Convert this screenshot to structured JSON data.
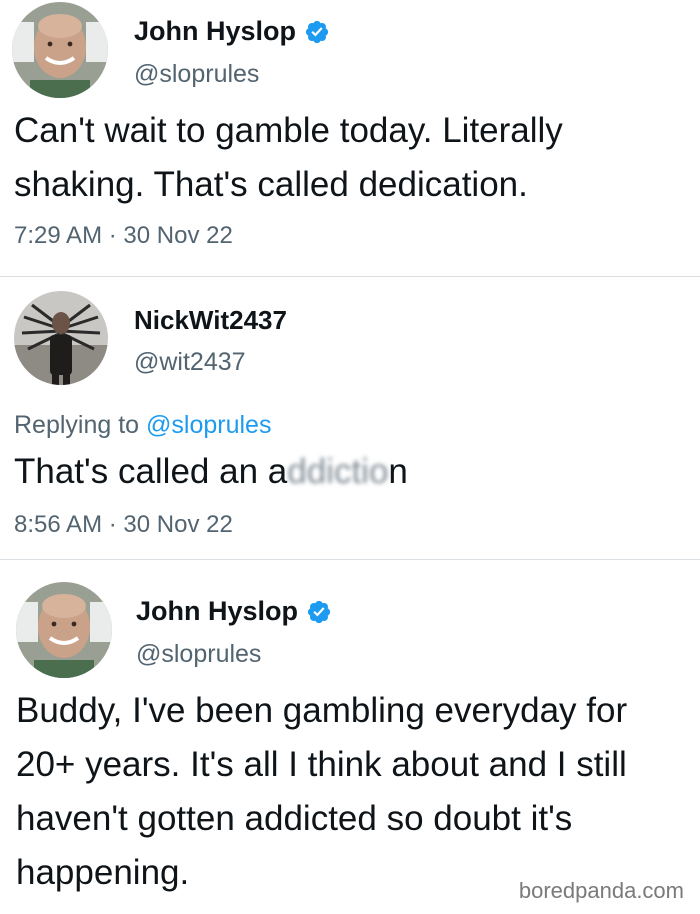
{
  "tweets": [
    {
      "display_name": "John Hyslop",
      "handle": "@sloprules",
      "verified": true,
      "text": "Can't wait to gamble today. Literally shaking. That's called dedication.",
      "time": "7:29 AM",
      "separator": "·",
      "date": "30 Nov 22"
    },
    {
      "display_name": "NickWit2437",
      "handle": "@wit2437",
      "verified": false,
      "replying_prefix": "Replying to",
      "replying_handle": "@sloprules",
      "text_before": "That's called an a",
      "text_blurred": "ddictio",
      "text_after": "n",
      "time": "8:56 AM",
      "separator": "·",
      "date": "30 Nov 22"
    },
    {
      "display_name": "John Hyslop",
      "handle": "@sloprules",
      "verified": true,
      "text": "Buddy, I've been gambling everyday for 20+ years. It's all I think about and I still haven't gotten addicted so doubt it's happening."
    }
  ],
  "watermark": "boredpanda.com",
  "colors": {
    "verified": "#1d9bf0",
    "handle_gray": "#536471",
    "mention_blue": "#1d9bf0",
    "divider": "#dadfe3"
  }
}
